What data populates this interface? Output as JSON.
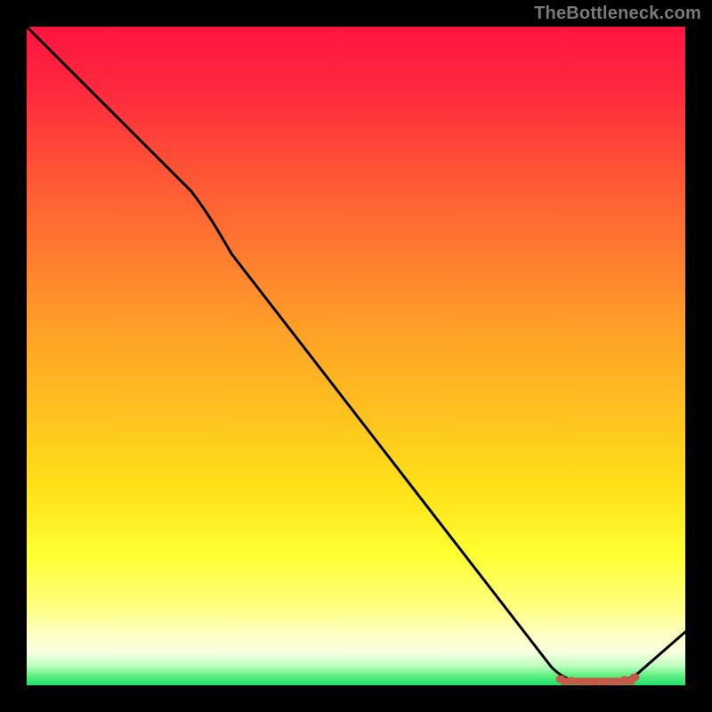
{
  "watermark": "TheBottleneck.com",
  "chart_data": {
    "type": "line",
    "title": "",
    "xlabel": "",
    "ylabel": "",
    "xlim": [
      0,
      100
    ],
    "ylim": [
      0,
      100
    ],
    "series": [
      {
        "name": "curve",
        "x": [
          0,
          25,
          82,
          87,
          92,
          100
        ],
        "y": [
          100,
          75,
          1,
          0,
          0,
          8
        ]
      }
    ],
    "markers": {
      "name": "selected-range",
      "x": [
        82,
        84,
        86,
        88,
        90,
        92
      ],
      "y": [
        0.8,
        0.5,
        0.3,
        0.3,
        0.4,
        0.6
      ],
      "color": "#d06050"
    },
    "background": "heat-gradient-red-to-green"
  }
}
